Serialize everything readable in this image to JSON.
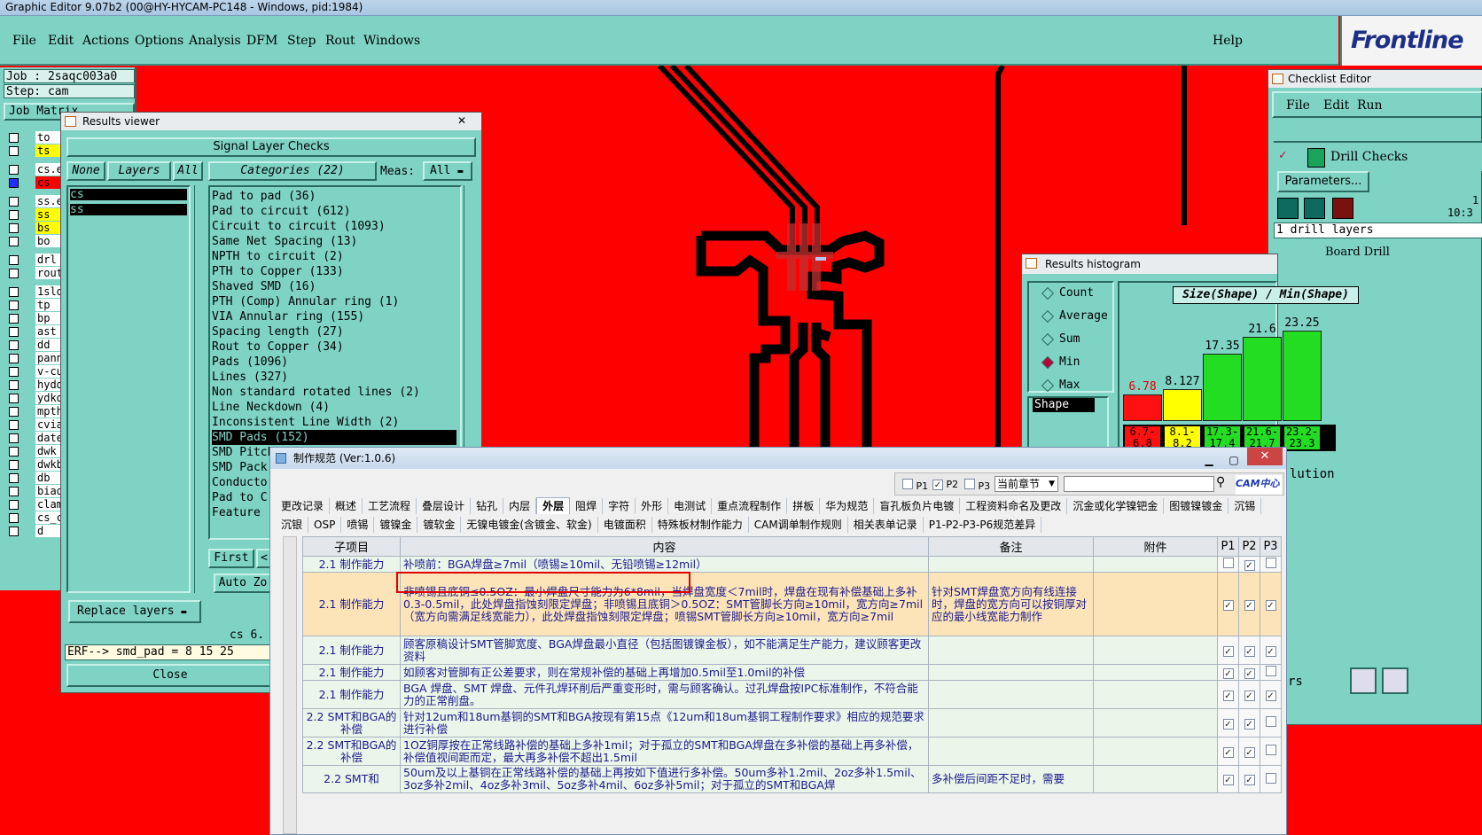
{
  "window": {
    "title": "Graphic Editor 9.07b2 (00@HY-HYCAM-PC148 - Windows, pid:1984)"
  },
  "menu": {
    "items": [
      "File",
      "Edit",
      "Actions",
      "Options",
      "Analysis",
      "DFM",
      "Step",
      "Rout",
      "Windows"
    ],
    "help": "Help"
  },
  "logo": {
    "text": "Frontline"
  },
  "left": {
    "job": "Job : 2saqc003a0",
    "step": "Step: cam",
    "matrix_btn": "Job Matrix",
    "layers": [
      "to",
      "ts",
      "cs.e",
      "cs",
      "ss.e",
      "ss",
      "bs",
      "bo",
      "drl",
      "rout",
      "1slo",
      "tp",
      "bp",
      "ast",
      "dd",
      "pann",
      "v-cu",
      "hydd",
      "ydkd",
      "mpth",
      "cvia",
      "date",
      "dwk",
      "dwkb",
      "db",
      "biaq",
      "clam",
      "cs_c",
      "d"
    ]
  },
  "results_viewer": {
    "title": "Results viewer",
    "close_x": "✕",
    "header": "Signal Layer Checks",
    "none_btn": "None",
    "layers_btn": "Layers",
    "all_btn": "All",
    "categories_btn": "Categories (22)",
    "meas_label": "Meas:",
    "meas_value": "All",
    "layer_list": [
      "cs",
      "ss"
    ],
    "categories": [
      "Pad to pad (36)",
      "Pad to circuit (612)",
      "Circuit to circuit (1093)",
      "Same Net Spacing (13)",
      "NPTH to circuit (2)",
      "PTH to Copper (133)",
      "Shaved SMD (16)",
      "PTH (Comp) Annular ring (1)",
      "VIA Annular ring (155)",
      "Spacing length (27)",
      "Rout to Copper (34)",
      "Pads (1096)",
      "Lines (327)",
      "Non standard rotated lines (2)",
      "Line Neckdown (4)",
      "Inconsistent Line Width (2)",
      "SMD Pads (152)",
      "SMD Pitch",
      "SMD Pack",
      "Conducto",
      "Pad to C",
      "Feature"
    ],
    "selected_index": 16,
    "first_btn": "First",
    "prev_btn": "<",
    "autozoom_btn": "Auto Zo",
    "replace_btn": "Replace layers",
    "status_layer": "cs 6.",
    "erf": "ERF--> smd_pad = 8 15 25",
    "close_btn": "Close"
  },
  "histogram": {
    "title": "Results histogram",
    "options": [
      "Count",
      "Average",
      "Sum",
      "Min",
      "Max"
    ],
    "selected": "Min",
    "shape_label": "Shape",
    "chart_title": "Size(Shape) / Min(Shape)",
    "footer_fragment": "lution"
  },
  "chart_data": {
    "type": "bar",
    "title": "Size(Shape) / Min(Shape)",
    "categories": [
      "6.7-6.8",
      "8.1-8.2",
      "17.3-17.4",
      "21.6-21.7",
      "23.2-23.3"
    ],
    "values": [
      6.78,
      8.127,
      17.35,
      21.6,
      23.25
    ],
    "value_labels": [
      "6.78",
      "8.127",
      "17.35",
      "21.6",
      "23.25"
    ],
    "category_labels": [
      [
        "6.7-",
        "6.8"
      ],
      [
        "8.1-",
        "8.2"
      ],
      [
        "17.3-",
        "17.4"
      ],
      [
        "21.6-",
        "21.7"
      ],
      [
        "23.2-",
        "23.3"
      ]
    ],
    "colors": [
      "#ff1010",
      "#ffff00",
      "#22dd22",
      "#22dd22",
      "#22dd22"
    ],
    "ylim": [
      0,
      25
    ]
  },
  "checklist": {
    "title": "Checklist Editor",
    "menu": [
      "File",
      "Edit",
      "Run"
    ],
    "item": "Drill Checks",
    "params_btn": "Parameters...",
    "time": "10:3",
    "time_top": "1",
    "status": "1 drill layers",
    "next_item": "Board Drill",
    "rs_fragment": "rs"
  },
  "spec": {
    "title": "制作规范 (Ver:1.0.6)",
    "p_filters": [
      "P1",
      "P2",
      "P3"
    ],
    "chapter_select": "当前章节",
    "search_placeholder": "",
    "cam_logo": "CAM中心",
    "tabs_row1": [
      "更改记录",
      "概述",
      "工艺流程",
      "叠层设计",
      "钻孔",
      "内层",
      "外层",
      "阻焊",
      "字符",
      "外形",
      "电测试",
      "重点流程制作",
      "拼板",
      "华为规范",
      "盲孔板负片电镀",
      "工程资料命名及更改",
      "沉金或化学镍钯金",
      "图镀镍镀金",
      "沉锡"
    ],
    "active_tab": "外层",
    "tabs_row2": [
      "沉银",
      "OSP",
      "喷锡",
      "镀镍金",
      "镀软金",
      "无镍电镀金(含镀金、软金)",
      "电镀面积",
      "特殊板材制作能力",
      "CAM调单制作规则",
      "相关表单记录",
      "P1-P2-P3-P6规范差异"
    ],
    "columns": [
      "子项目",
      "内容",
      "备注",
      "附件",
      "P1",
      "P2",
      "P3"
    ],
    "rows": [
      {
        "sub": "2.1 制作能力",
        "content": "补喷前：BGA焊盘≥7mil（喷锡≥10mil、无铅喷锡≥12mil）",
        "note": "",
        "p1": false,
        "p2": true,
        "p3": false,
        "hl": false
      },
      {
        "sub": "2.1 制作能力",
        "content": "非喷锡且底铜≤0.5OZ：最小焊盘尺寸能力为6*8mil，当焊盘宽度＜7mil时，焊盘在现有补偿基础上多补0.3-0.5mil，此处焊盘指蚀刻限定焊盘；非喷锡且底铜＞0.5OZ：SMT管脚长方向≥10mil，宽方向≥7mil（宽方向需满足线宽能力），此处焊盘指蚀刻限定焊盘；喷锡SMT管脚长方向≥10mil，宽方向≥7mil",
        "note": "针对SMT焊盘宽方向有线连接时，焊盘的宽方向可以按铜厚对应的最小线宽能力制作",
        "p1": true,
        "p2": true,
        "p3": true,
        "hl": true
      },
      {
        "sub": "2.1 制作能力",
        "content": "顾客原稿设计SMT管脚宽度、BGA焊盘最小直径（包括图镀镍金板），如不能满足生产能力，建议顾客更改资料",
        "note": "",
        "p1": true,
        "p2": true,
        "p3": true,
        "hl": false
      },
      {
        "sub": "2.1 制作能力",
        "content": "如顾客对管脚有正公差要求，则在常规补偿的基础上再增加0.5mil至1.0mil的补偿",
        "note": "",
        "p1": true,
        "p2": true,
        "p3": false,
        "hl": false
      },
      {
        "sub": "2.1 制作能力",
        "content": "BGA 焊盘、SMT 焊盘、元件孔焊环削后严重变形时，需与顾客确认。过孔焊盘按IPC标准制作，不符合能力的正常削盘。",
        "note": "",
        "p1": true,
        "p2": true,
        "p3": true,
        "hl": false
      },
      {
        "sub": "2.2 SMT和BGA的补偿",
        "content": "针对12um和18um基铜的SMT和BGA按现有第15点《12um和18um基铜工程制作要求》相应的规范要求进行补偿",
        "note": "",
        "p1": true,
        "p2": true,
        "p3": false,
        "hl": false
      },
      {
        "sub": "2.2 SMT和BGA的补偿",
        "content": "1OZ铜厚按在正常线路补偿的基础上多补1mil；对于孤立的SMT和BGA焊盘在多补偿的基础上再多补偿，补偿值视间距而定，最大再多补偿不超出1.5mil",
        "note": "",
        "p1": true,
        "p2": true,
        "p3": false,
        "hl": false
      },
      {
        "sub": "2.2 SMT和",
        "content": "50um及以上基铜在正常线路补偿的基础上再按如下值进行多补偿。50um多补1.2mil、2oz多补1.5mil、3oz多补2mil、4oz多补3mil、5oz多补4mil、6oz多补5mil；对于孤立的SMT和BGA焊",
        "note": "多补偿后间距不足时，需要",
        "p1": true,
        "p2": true,
        "p3": false,
        "hl": false
      }
    ]
  }
}
